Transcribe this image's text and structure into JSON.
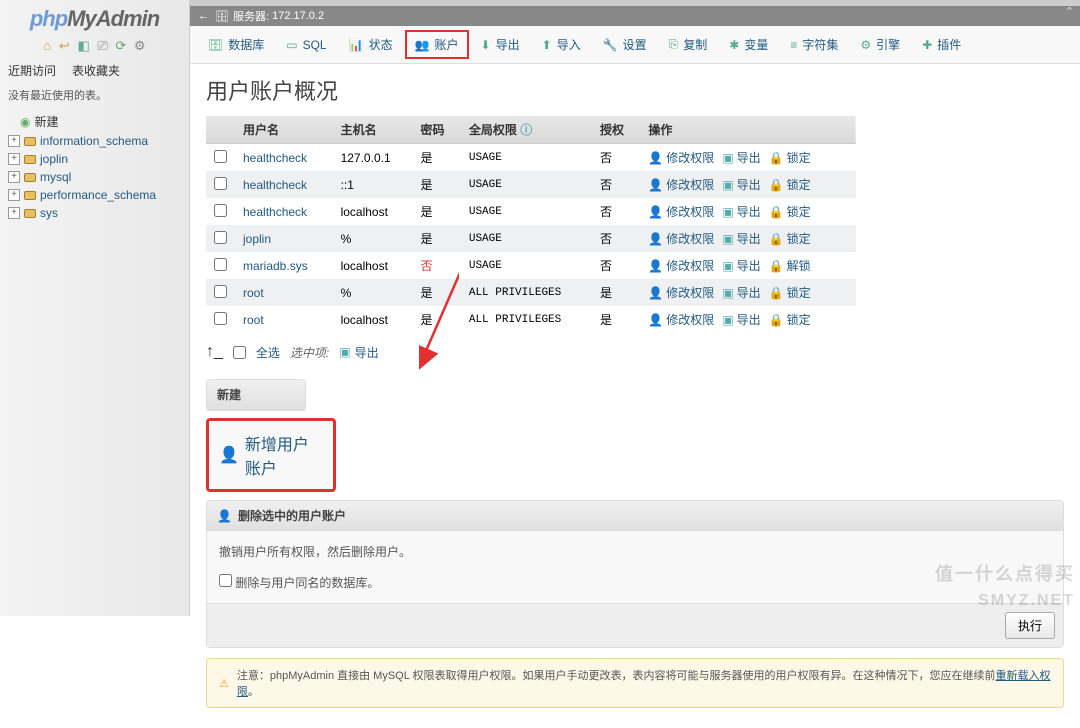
{
  "logo": {
    "p1": "php",
    "p2": "MyAdmin"
  },
  "sidebar": {
    "tabs": [
      "近期访问",
      "表收藏夹"
    ],
    "emptyMsg": "没有最近使用的表。",
    "newLabel": "新建",
    "dbs": [
      "information_schema",
      "joplin",
      "mysql",
      "performance_schema",
      "sys"
    ]
  },
  "server": {
    "label": "服务器:",
    "host": "172.17.0.2"
  },
  "tabs": [
    {
      "icon": "db-icon",
      "label": "数据库"
    },
    {
      "icon": "sql-icon",
      "label": "SQL"
    },
    {
      "icon": "status-icon",
      "label": "状态"
    },
    {
      "icon": "accounts-icon",
      "label": "账户",
      "hl": true
    },
    {
      "icon": "export-icon",
      "label": "导出"
    },
    {
      "icon": "import-icon",
      "label": "导入"
    },
    {
      "icon": "settings-icon",
      "label": "设置"
    },
    {
      "icon": "replicate-icon",
      "label": "复制"
    },
    {
      "icon": "variables-icon",
      "label": "变量"
    },
    {
      "icon": "charset-icon",
      "label": "字符集"
    },
    {
      "icon": "engine-icon",
      "label": "引擎"
    },
    {
      "icon": "plugin-icon",
      "label": "插件"
    }
  ],
  "heading": "用户账户概况",
  "cols": {
    "user": "用户名",
    "host": "主机名",
    "pwd": "密码",
    "global": "全局权限",
    "grant": "授权",
    "ops": "操作"
  },
  "rows": [
    {
      "user": "healthcheck",
      "host": "127.0.0.1",
      "pwd": "是",
      "priv": "USAGE",
      "grant": "否"
    },
    {
      "user": "healthcheck",
      "host": "::1",
      "pwd": "是",
      "priv": "USAGE",
      "grant": "否"
    },
    {
      "user": "healthcheck",
      "host": "localhost",
      "pwd": "是",
      "priv": "USAGE",
      "grant": "否"
    },
    {
      "user": "joplin",
      "host": "%",
      "pwd": "是",
      "priv": "USAGE",
      "grant": "否"
    },
    {
      "user": "mariadb.sys",
      "host": "localhost",
      "pwd": "否",
      "pwdRed": true,
      "priv": "USAGE",
      "grant": "否",
      "unlock": true
    },
    {
      "user": "root",
      "host": "%",
      "pwd": "是",
      "priv": "ALL PRIVILEGES",
      "grant": "是"
    },
    {
      "user": "root",
      "host": "localhost",
      "pwd": "是",
      "priv": "ALL PRIVILEGES",
      "grant": "是"
    }
  ],
  "ops": {
    "edit": "修改权限",
    "export": "导出",
    "lock": "锁定",
    "unlock": "解锁"
  },
  "selall": {
    "all": "全选",
    "with": "选中项:",
    "export": "导出"
  },
  "newbox": {
    "title": "新建",
    "add": "新增用户账户"
  },
  "delbox": {
    "title": "删除选中的用户账户",
    "msg": "撤销用户所有权限，然后删除用户。",
    "chk": "删除与用户同名的数据库。"
  },
  "exec": "执行",
  "notice": {
    "label": "注意：",
    "msg": "phpMyAdmin 直接由 MySQL 权限表取得用户权限。如果用户手动更改表，表内容将可能与服务器使用的用户权限有异。在这种情况下，您应在继续前",
    "link": "重新载入权限",
    "tail": "。"
  },
  "wm1": "值一什么点得买",
  "wm2": "SMYZ.NET"
}
